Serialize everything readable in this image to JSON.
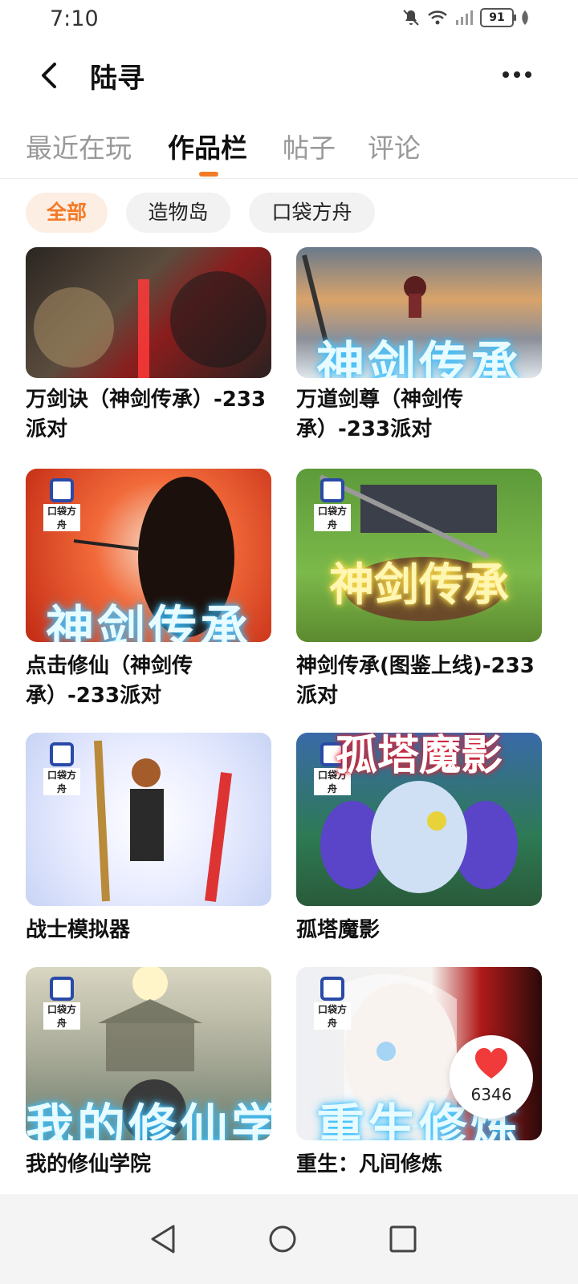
{
  "status_bar": {
    "time": "7:10",
    "battery": "91"
  },
  "header": {
    "title": "陆寻"
  },
  "tabs": [
    {
      "label": "最近在玩"
    },
    {
      "label": "作品栏"
    },
    {
      "label": "帖子"
    },
    {
      "label": "评论"
    }
  ],
  "filters": [
    {
      "label": "全部"
    },
    {
      "label": "造物岛"
    },
    {
      "label": "口袋方舟"
    }
  ],
  "logo_label": "口袋方舟",
  "games": [
    {
      "title": "万剑诀（神剑传承）-233派对",
      "thumb_text": ""
    },
    {
      "title": "万道剑尊（神剑传承）-233派对",
      "thumb_text": "神剑传承"
    },
    {
      "title": "点击修仙（神剑传承）-233派对",
      "thumb_text": "神剑传承"
    },
    {
      "title": "神剑传承(图鉴上线)-233派对",
      "thumb_text": "神剑传承"
    },
    {
      "title": "战士模拟器",
      "thumb_text": ""
    },
    {
      "title": "孤塔魔影",
      "thumb_text": "孤塔魔影"
    },
    {
      "title": "我的修仙学院",
      "thumb_text": "我的修仙学院"
    },
    {
      "title": "重生：凡间修炼",
      "thumb_text": "重生修炼"
    }
  ],
  "like": {
    "count": "6346"
  },
  "colors": {
    "accent": "#f47a26",
    "chip_active_bg": "#fdeee3"
  }
}
